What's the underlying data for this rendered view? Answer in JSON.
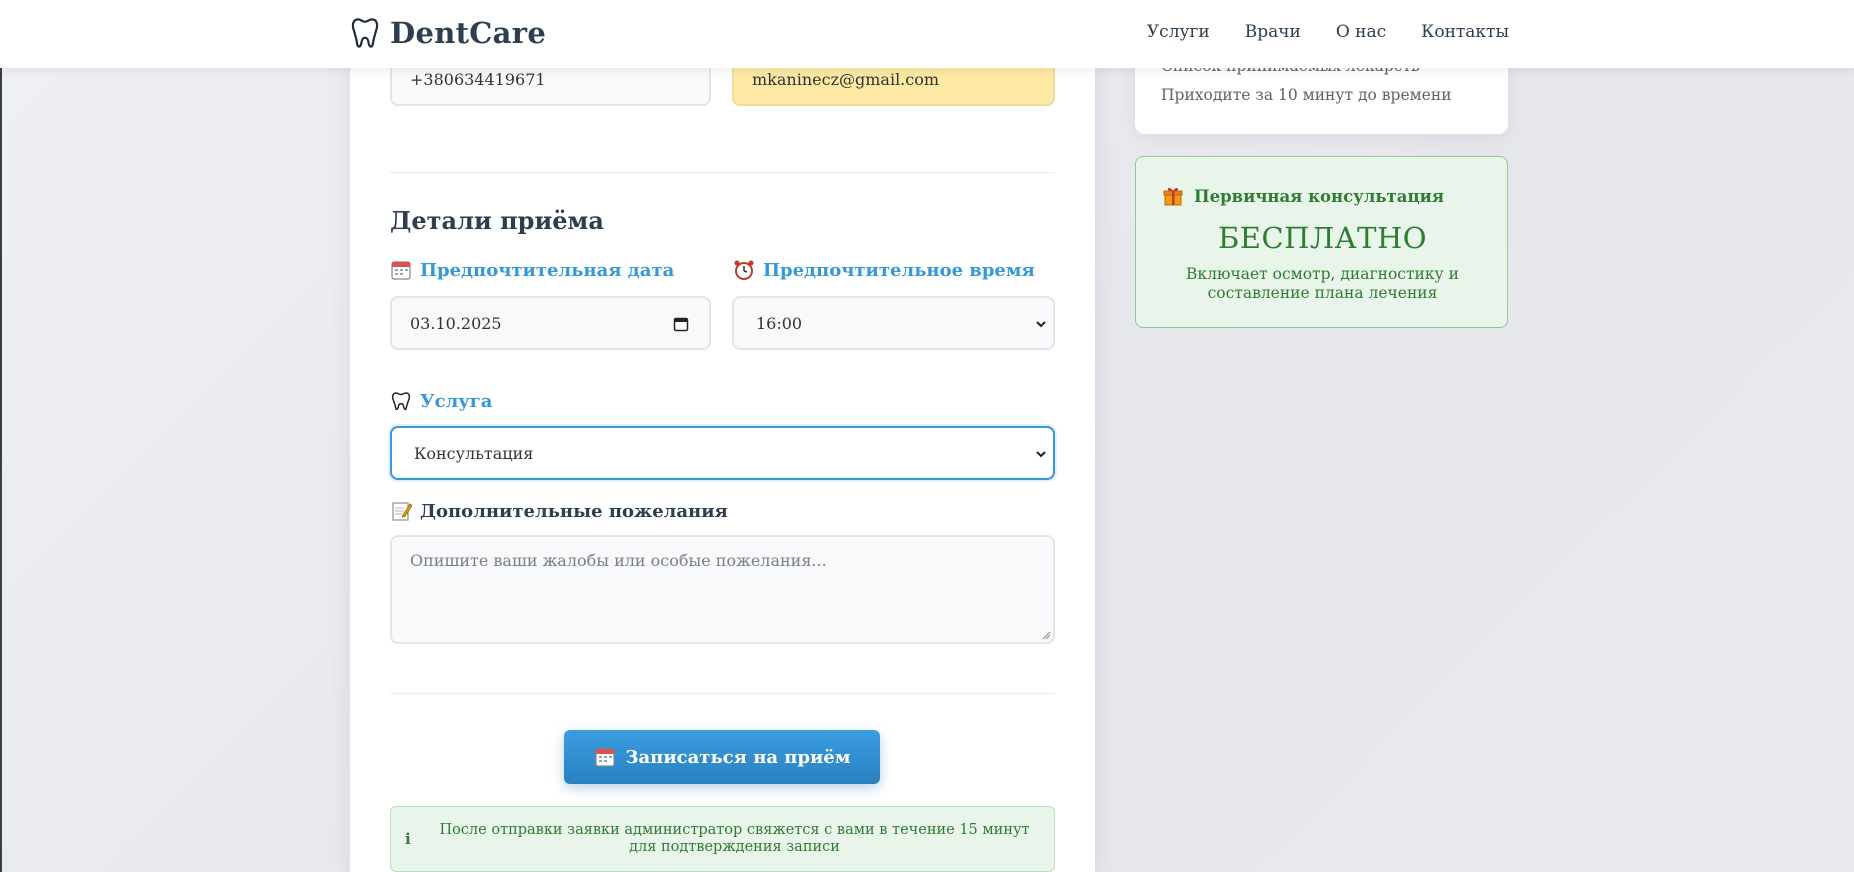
{
  "header": {
    "logo_text": "DentCare",
    "nav": [
      "Услуги",
      "Врачи",
      "О нас",
      "Контакты"
    ]
  },
  "form": {
    "phone_value": "+380634419671",
    "email_value": "mkaninecz@gmail.com",
    "section_title": "Детали приёма",
    "date_label": "Предпочтительная дата",
    "date_value": "03.10.2025",
    "time_label": "Предпочтительное время",
    "time_value": "16:00",
    "service_label": "Услуга",
    "service_value": "Консультация",
    "notes_label": "Дополнительные пожелания",
    "notes_placeholder": "Опишите ваши жалобы или особые пожелания...",
    "submit_label": "Записаться на приём",
    "notice_icon": "i",
    "notice_text": "После отправки заявки администратор свяжется с вами в течение 15 минут для подтверждения записи"
  },
  "sidebar": {
    "tips": [
      "Список принимаемых лекарств",
      "Приходите за 10 минут до времени"
    ],
    "offer_title": "Первичная консультация",
    "offer_price": "БЕСПЛАТНО",
    "offer_desc": "Включает осмотр, диагностику и составление плана лечения"
  },
  "colors": {
    "accent": "#3498db",
    "dark": "#2c3e50",
    "success": "#2e7d32",
    "success_bg": "#e9f5ea",
    "autofill": "#fde9a3"
  },
  "icons": [
    "tooth-icon",
    "calendar-icon",
    "alarm-clock-icon",
    "memo-icon",
    "gift-icon",
    "info-icon",
    "chevron-down-icon"
  ]
}
